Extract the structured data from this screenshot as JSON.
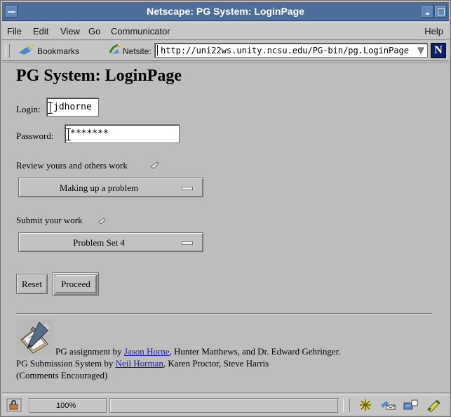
{
  "window": {
    "title": "Netscape: PG System: LoginPage"
  },
  "menu": {
    "items": [
      "File",
      "Edit",
      "View",
      "Go",
      "Communicator"
    ],
    "help": "Help"
  },
  "location": {
    "bookmarks_label": "Bookmarks",
    "netsite_label": "Netsite:",
    "url": "http://uni22ws.unity.ncsu.edu/PG-bin/pg.LoginPage"
  },
  "page": {
    "title": "PG System: LoginPage",
    "login_label": "Login:",
    "login_value": "jdhorne",
    "password_label": "Password:",
    "password_value": "*******",
    "review_label": "Review yours and others work",
    "review_selected": "Making up a problem",
    "submit_label": "Submit your work",
    "submit_selected": "Problem Set 4",
    "reset_label": "Reset",
    "proceed_label": "Proceed",
    "credits": {
      "line1_prefix": "PG assignment by ",
      "line1_link": "Jason Horne",
      "line1_suffix": ", Hunter Matthews, and Dr. Edward Gehringer.",
      "line2_prefix": "PG Submission System by ",
      "line2_link": "Neil Horman",
      "line2_suffix": ", Karen Proctor, Steve Harris",
      "line3": "(Comments Encouraged)"
    }
  },
  "status": {
    "zoom": "100%"
  }
}
